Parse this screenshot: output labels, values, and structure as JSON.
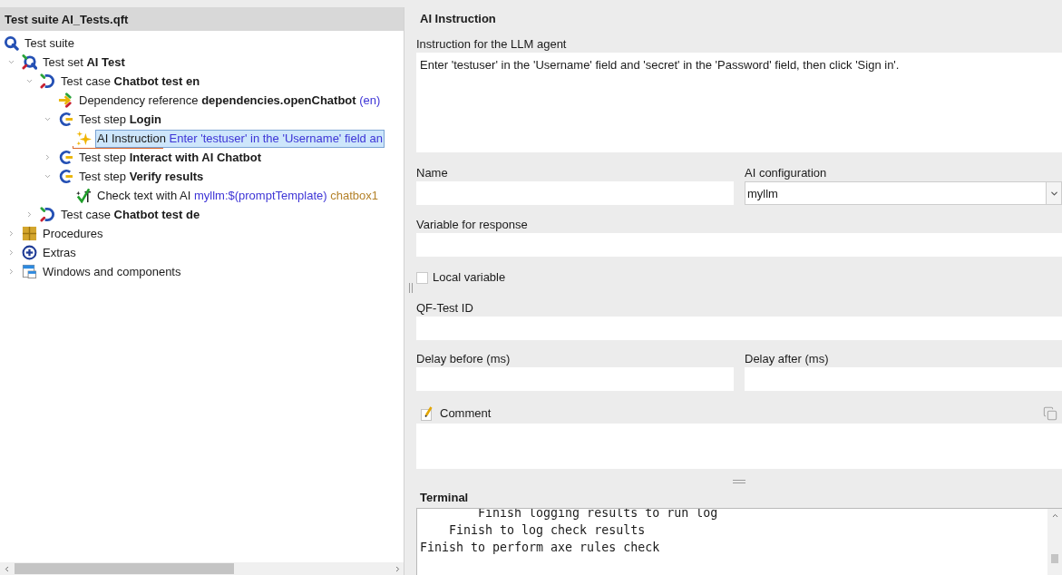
{
  "tree_panel": {
    "title": "Test suite AI_Tests.qft",
    "root": {
      "kind": "suite",
      "type_label": "Test suite",
      "selected": false,
      "children": [
        {
          "kind": "set",
          "type_label": "Test set",
          "name": "AI Test",
          "expanded": true,
          "selected": false,
          "children": [
            {
              "kind": "case",
              "type_label": "Test case",
              "name": "Chatbot test en",
              "expanded": true,
              "selected": false,
              "children": [
                {
                  "kind": "dependency",
                  "type_label": "Dependency reference",
                  "name": "dependencies.openChatbot",
                  "detail": "(en)",
                  "selected": false
                },
                {
                  "kind": "step",
                  "type_label": "Test step",
                  "name": "Login",
                  "expanded": true,
                  "selected": false,
                  "children": [
                    {
                      "kind": "ai-instruction",
                      "type_label": "AI Instruction",
                      "detail": "Enter 'testuser' in the 'Username' field an",
                      "selected": true
                    }
                  ]
                },
                {
                  "kind": "step",
                  "type_label": "Test step",
                  "name": "Interact with AI Chatbot",
                  "expanded": false,
                  "selected": false
                },
                {
                  "kind": "step",
                  "type_label": "Test step",
                  "name": "Verify results",
                  "expanded": true,
                  "selected": false,
                  "children": [
                    {
                      "kind": "ai-check",
                      "type_label": "Check text with AI",
                      "detail": "myllm:$(promptTemplate)",
                      "target": "chatbox1",
                      "selected": false
                    }
                  ]
                }
              ]
            },
            {
              "kind": "case",
              "type_label": "Test case",
              "name": "Chatbot test de",
              "expanded": false,
              "selected": false
            }
          ]
        },
        {
          "kind": "procedures",
          "type_label": "Procedures",
          "expanded": false,
          "selected": false
        },
        {
          "kind": "extras",
          "type_label": "Extras",
          "expanded": false,
          "selected": false
        },
        {
          "kind": "windows",
          "type_label": "Windows and components",
          "expanded": false,
          "selected": false
        }
      ]
    }
  },
  "editor": {
    "title": "AI Instruction",
    "instruction": {
      "label": "Instruction for the LLM agent",
      "value": "Enter 'testuser' in the 'Username' field and 'secret' in the 'Password' field, then click 'Sign in'."
    },
    "name": {
      "label": "Name"
    },
    "ai_configuration": {
      "label": "AI configuration",
      "value": "myllm"
    },
    "response_variable": {
      "label": "Variable for response"
    },
    "local_variable": {
      "label": "Local variable",
      "checked": false
    },
    "qftest_id": {
      "label": "QF-Test ID"
    },
    "delay_before": {
      "label": "Delay before (ms)"
    },
    "delay_after": {
      "label": "Delay after (ms)"
    },
    "comment": {
      "label": "Comment"
    }
  },
  "terminal": {
    "title": "Terminal",
    "lines": [
      "        Finish logging results to run log",
      "    Finish to log check results",
      "Finish to perform axe rules check"
    ]
  }
}
